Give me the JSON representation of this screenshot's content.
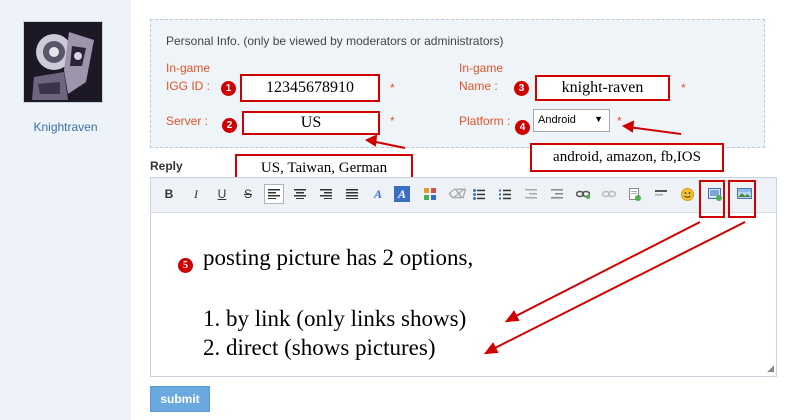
{
  "user": {
    "name": "Knightraven"
  },
  "personal_info": {
    "title": "Personal Info. (only be viewed by moderators or administrators)",
    "igg_label_top": "In-game",
    "igg_label": "IGG ID :",
    "igg_value": "12345678910",
    "name_label_top": "In-game",
    "name_label": "Name :",
    "name_value": "knight-raven",
    "server_label": "Server :",
    "server_value": "US",
    "platform_label": "Platform :",
    "platform_value": "Android",
    "required_mark": "*"
  },
  "annotations": {
    "badge1": "1",
    "badge2": "2",
    "badge3": "3",
    "badge4": "4",
    "badge5": "5",
    "server_options": "US, Taiwan, German",
    "platform_options": "android, amazon, fb,IOS"
  },
  "reply": {
    "label": "Reply",
    "toolbar": {
      "bold": "B",
      "italic": "I",
      "underline": "U",
      "strike": "S",
      "font_color": "A",
      "bg_color": "A"
    },
    "content": {
      "line1": "posting picture has 2 options,",
      "line2": "1. by link (only links shows)",
      "line3": "2. direct (shows pictures)"
    }
  },
  "submit_label": "submit",
  "colors": {
    "accent_red": "#d00000",
    "label_orange": "#e0542b",
    "submit_blue": "#6aa8e0",
    "sidebar_bg": "#eef3f9"
  }
}
